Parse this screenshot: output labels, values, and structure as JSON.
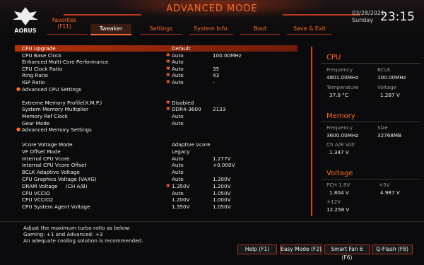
{
  "header": {
    "logo_text": "AORUS",
    "mode_title": "ADVANCED MODE",
    "date": "03/28/2021",
    "day": "Sunday",
    "time": "23:15"
  },
  "tabs": {
    "favorites_line1": "Favorites",
    "favorites_line2": "(F11)",
    "items": [
      "Tweaker",
      "Settings",
      "System Info.",
      "Boot",
      "Save & Exit"
    ],
    "active": "Tweaker"
  },
  "settings": {
    "cpu_upgrade": {
      "label": "CPU Upgrade",
      "value": "Default"
    },
    "cpu_base_clock": {
      "label": "CPU Base Clock",
      "value": "Auto",
      "current": "100.00MHz"
    },
    "enhanced_multicore": {
      "label": "Enhanced Multi-Core Performance",
      "value": "Auto"
    },
    "cpu_clock_ratio": {
      "label": "CPU Clock Ratio",
      "value": "Auto",
      "current": "35"
    },
    "ring_ratio": {
      "label": "Ring Ratio",
      "value": "Auto",
      "current": "43"
    },
    "igp_ratio": {
      "label": "IGP Ratio",
      "value": "Auto",
      "current": "-"
    },
    "advanced_cpu_settings": {
      "label": "Advanced CPU Settings"
    },
    "xmp": {
      "label": "Extreme Memory Profile(X.M.P.)",
      "value": "Disabled"
    },
    "sys_mem_multiplier": {
      "label": "System Memory Multiplier",
      "value": "DDR4-3600",
      "current": "2133"
    },
    "mem_ref_clock": {
      "label": "Memory Ref Clock",
      "value": "Auto"
    },
    "gear_mode": {
      "label": "Gear Mode",
      "value": "Auto"
    },
    "advanced_memory_settings": {
      "label": "Advanced Memory Settings"
    },
    "vcore_mode": {
      "label": "Vcore Voltage Mode",
      "value": "Adaptive Vcore"
    },
    "vf_offset_mode": {
      "label": "VF Offset Mode",
      "value": "Legacy"
    },
    "internal_vcore": {
      "label": "Internal CPU Vcore",
      "value": "Auto",
      "current": "1.277V"
    },
    "internal_vcore_offset": {
      "label": "Internal CPU Vcore Offset",
      "value": "Auto",
      "current": "+0.000V"
    },
    "bclk_adaptive": {
      "label": "BCLK Adaptive Voltage",
      "value": "Auto"
    },
    "cpu_graphics_voltage": {
      "label": "CPU Graphics Voltage (VAXG)",
      "value": "Auto",
      "current": "1.200V"
    },
    "dram_voltage": {
      "label": "DRAM Voltage     (CH A/B)",
      "value": "1.350V",
      "current": "1.200V"
    },
    "cpu_vccio": {
      "label": "CPU VCCIO",
      "value": "Auto",
      "current": "1.050V"
    },
    "cpu_vccio2": {
      "label": "CPU VCCIO2",
      "value": "1.200V",
      "current": "1.000V"
    },
    "cpu_sa_voltage": {
      "label": "CPU System Agent Voltage",
      "value": "1.350V",
      "current": "1.050V"
    }
  },
  "info": {
    "cpu": {
      "title": "CPU",
      "frequency_label": "Frequency",
      "frequency": "4801.00MHz",
      "bclk_label": "BCLK",
      "bclk": "100.00MHz",
      "temperature_label": "Temperature",
      "temperature": "37.0 °C",
      "voltage_label": "Voltage",
      "voltage": "1.287 V"
    },
    "memory": {
      "title": "Memory",
      "frequency_label": "Frequency",
      "frequency": "3600.00MHz",
      "size_label": "Size",
      "size": "32768MB",
      "volt_label": "Ch A/B Volt",
      "volt": "1.347 V"
    },
    "voltage": {
      "title": "Voltage",
      "pch_label": "PCH 1.8V",
      "pch": "1.804 V",
      "p5_label": "+5V",
      "p5": "4.987 V",
      "p12_label": "+12V",
      "p12": "12.258 V"
    }
  },
  "help": {
    "line1": "Adjust the maximum turbo ratio as below:",
    "line2": "Gaming: +1 and Advanced: +3",
    "line3": "An adequate cooling solution is recommended."
  },
  "footer_buttons": {
    "help": "Help (F1)",
    "easy_mode": "Easy Mode (F2)",
    "smart_fan": "Smart Fan 6 (F6)",
    "qflash": "Q-Flash (F8)"
  },
  "colors": {
    "accent": "#ff6a2a",
    "highlight": "#b3300d",
    "background": "#0b0b0d"
  }
}
